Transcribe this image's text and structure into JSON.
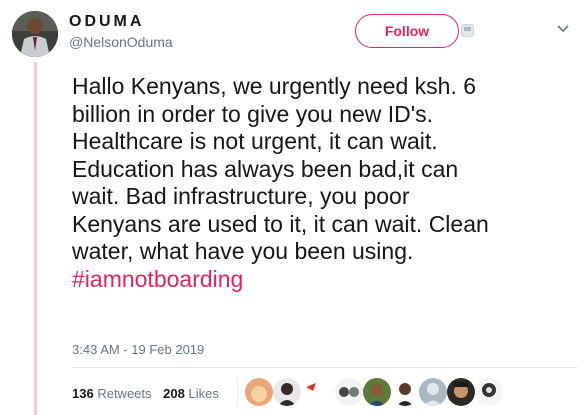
{
  "author": {
    "display_name": "ODUMA",
    "username": "@NelsonOduma"
  },
  "actions": {
    "follow_label": "Follow"
  },
  "tweet": {
    "text": "Hallo Kenyans, we urgently need ksh. 6\nbillion in order to give you new ID's.\nHealthcare is not urgent, it can wait.\nEducation has always been bad,it can\nwait. Bad infrastructure, you poor\nKenyans are used to it, it can wait. Clean\nwater, what have you been using.\n",
    "hashtag": "#iamnotboarding",
    "timestamp": "3:43 AM - 19 Feb 2019"
  },
  "stats": {
    "retweets_count": "136",
    "retweets_label": "Retweets",
    "likes_count": "208",
    "likes_label": "Likes"
  },
  "colors": {
    "accent": "#e0245e",
    "secondary_text": "#657786",
    "thread_line": "#f3c7d6"
  },
  "icons": [
    "follow-glyph-icon",
    "chevron-down-icon"
  ]
}
